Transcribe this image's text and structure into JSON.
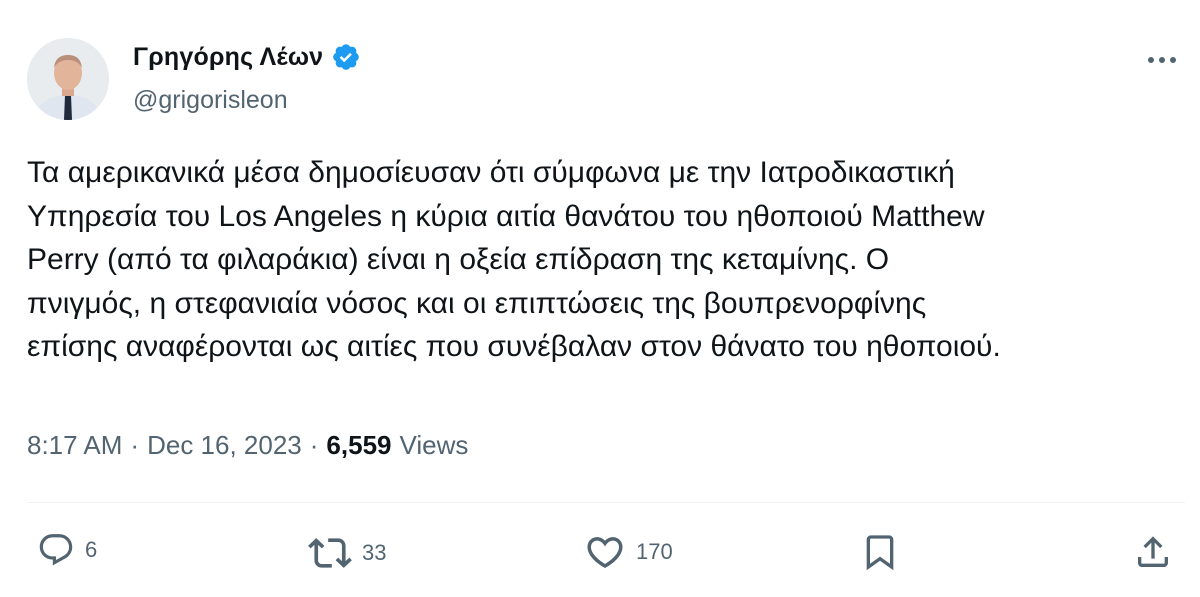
{
  "author": {
    "display_name": "Γρηγόρης Λέων",
    "handle": "@grigorisleon",
    "verified": true
  },
  "tweet": {
    "text": "Τα αμερικανικά μέσα δημοσίευσαν ότι σύμφωνα με την Ιατροδικαστική\nΥπηρεσία του Los Angeles η κύρια αιτία θανάτου του ηθοποιού Matthew\nPerry (από τα φιλαράκια) είναι η οξεία επίδραση της κεταμίνης. Ο\nπνιγμός, η στεφανιαία νόσος και οι επιπτώσεις της βουπρενορφίνης\nεπίσης αναφέρονται ως αιτίες που συνέβαλαν στον θάνατο του ηθοποιού."
  },
  "meta": {
    "time": "8:17 AM",
    "separator": "·",
    "date": "Dec 16, 2023",
    "views_count": "6,559",
    "views_label": "Views"
  },
  "actions": {
    "replies": "6",
    "retweets": "33",
    "likes": "170"
  },
  "colors": {
    "verified": "#1d9bf0",
    "text": "#0f1419",
    "secondary": "#536471",
    "divider": "#eff3f4"
  },
  "icons": [
    "verified-badge-icon",
    "more-icon",
    "reply-icon",
    "retweet-icon",
    "like-icon",
    "bookmark-icon",
    "share-icon"
  ]
}
